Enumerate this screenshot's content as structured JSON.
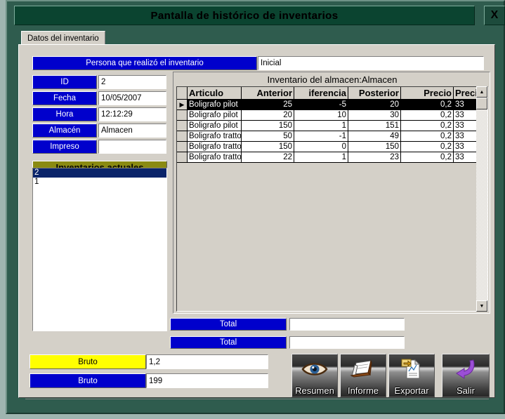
{
  "window": {
    "title": "Pantalla de histórico de inventarios",
    "close_label": "X"
  },
  "tab": {
    "label": "Datos del inventario"
  },
  "header": {
    "person_label": "Persona que realizó el inventario",
    "person_value": "Inicial"
  },
  "fields": [
    {
      "label": "ID",
      "value": "2"
    },
    {
      "label": "Fecha",
      "value": "10/05/2007"
    },
    {
      "label": "Hora",
      "value": "12:12:29"
    },
    {
      "label": "Almacén",
      "value": "Almacen"
    },
    {
      "label": "Impreso",
      "value": ""
    }
  ],
  "listbox": {
    "header": "Inventarios actuales",
    "items": [
      "2",
      "1"
    ],
    "selected_index": 0
  },
  "grid": {
    "title": "Inventario del almacen:Almacen",
    "columns": [
      "Articulo",
      "Anterior",
      "iferencia",
      "Posterior",
      "Precio",
      "Precio"
    ],
    "rows": [
      {
        "articulo": "Boligrafo pilot",
        "anterior": "25",
        "diferencia": "-5",
        "posterior": "20",
        "precio1": "0,2",
        "precio2": "33",
        "selected": true
      },
      {
        "articulo": "Boligrafo pilot",
        "anterior": "20",
        "diferencia": "10",
        "posterior": "30",
        "precio1": "0,2",
        "precio2": "33",
        "selected": false
      },
      {
        "articulo": "Boligrafo pilot",
        "anterior": "150",
        "diferencia": "1",
        "posterior": "151",
        "precio1": "0,2",
        "precio2": "33",
        "selected": false
      },
      {
        "articulo": "Boligrafo tratto",
        "anterior": "50",
        "diferencia": "-1",
        "posterior": "49",
        "precio1": "0,2",
        "precio2": "33",
        "selected": false
      },
      {
        "articulo": "Boligrafo tratto",
        "anterior": "150",
        "diferencia": "0",
        "posterior": "150",
        "precio1": "0,2",
        "precio2": "33",
        "selected": false
      },
      {
        "articulo": "Boligrafo tratto",
        "anterior": "22",
        "diferencia": "1",
        "posterior": "23",
        "precio1": "0,2",
        "precio2": "33",
        "selected": false
      }
    ],
    "scroll_up": "▲",
    "scroll_down": "▼",
    "row_indicator": "▶"
  },
  "totals": [
    {
      "label": "Total",
      "value": ""
    },
    {
      "label": "Total",
      "value": ""
    }
  ],
  "gross": [
    {
      "label": "Bruto",
      "value": "1,2"
    },
    {
      "label": "Bruto",
      "value": "199"
    }
  ],
  "buttons": [
    {
      "label": "Resumen",
      "icon": "eye-icon"
    },
    {
      "label": "Informe",
      "icon": "clipboard-icon"
    },
    {
      "label": "Exportar",
      "icon": "export-document-icon"
    },
    {
      "label": "Salir",
      "icon": "exit-arrow-icon"
    }
  ],
  "colors": {
    "title_bar": "#0b4430",
    "window_frame": "#2f5c4e",
    "plate_blue": "#0000cc",
    "plate_yellow": "#ffff00",
    "plate_olive": "#8a8a12",
    "panel": "#d4d0c8",
    "selection": "#0a246a"
  }
}
